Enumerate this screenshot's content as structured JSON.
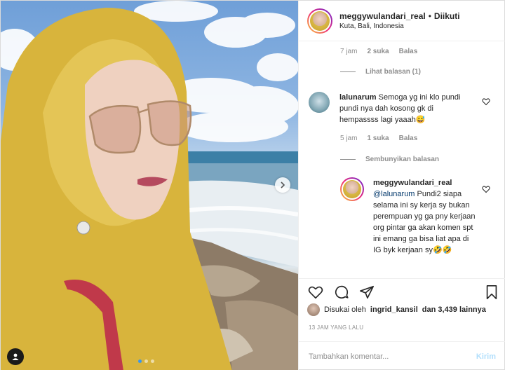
{
  "post": {
    "username": "meggywulandari_real",
    "separator": "•",
    "follow_label": "Diikuti",
    "location": "Kuta, Bali, Indonesia"
  },
  "comments": {
    "first_meta": {
      "time": "7 jam",
      "likes": "2 suka",
      "reply": "Balas"
    },
    "view_replies": "Lihat balasan (1)",
    "c2": {
      "username": "lalunarum",
      "text": "Semoga yg ini klo pundi pundi nya dah kosong gk di hempassss lagi yaaah😅",
      "time": "5 jam",
      "likes": "1 suka",
      "reply": "Balas"
    },
    "hide_replies": "Sembunyikan balasan",
    "reply1": {
      "username": "meggywulandari_real",
      "mention": "@lalunarum",
      "text": " Pundi2 siapa selama ini sy kerja sy bukan perempuan yg ga pny kerjaan org pintar ga akan komen spt ini emang ga bisa liat apa di IG byk kerjaan sy🤣🤣"
    }
  },
  "likes": {
    "prefix": "Disukai oleh",
    "user": "ingrid_kansil",
    "suffix": "dan 3,439 lainnya"
  },
  "timestamp": "13 JAM YANG LALU",
  "composer": {
    "placeholder": "Tambahkan komentar...",
    "post_label": "Kirim"
  },
  "icons": {
    "like": "heart-icon",
    "comment": "comment-icon",
    "share": "share-icon",
    "save": "bookmark-icon",
    "next": "chevron-right-icon",
    "tag": "user-tag-icon"
  },
  "colors": {
    "text": "#262626",
    "muted": "#8e8e8e",
    "link": "#00376b",
    "post_disabled": "#b2dffc",
    "carousel_active": "#3897f0"
  },
  "carousel": {
    "count": 3,
    "active": 1
  }
}
